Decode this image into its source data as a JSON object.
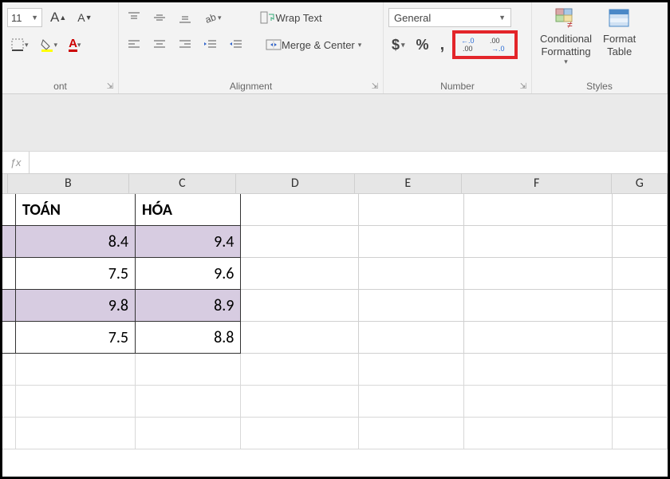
{
  "ribbon": {
    "font": {
      "size": "11",
      "group_label": "ont"
    },
    "alignment": {
      "wrap_text": "Wrap Text",
      "merge_center": "Merge & Center",
      "group_label": "Alignment"
    },
    "number": {
      "format": "General",
      "group_label": "Number"
    },
    "styles": {
      "conditional_formatting": "Conditional\nFormatting",
      "format_table": "Format\nTable",
      "group_label": "Styles"
    }
  },
  "columns": [
    "B",
    "C",
    "D",
    "E",
    "F",
    "G"
  ],
  "headers": {
    "B": "TOÁN",
    "C": "HÓA"
  },
  "chart_data": {
    "type": "table",
    "columns": [
      "TOÁN",
      "HÓA"
    ],
    "rows": [
      [
        8.4,
        9.4
      ],
      [
        7.5,
        9.6
      ],
      [
        9.8,
        8.9
      ],
      [
        7.5,
        8.8
      ]
    ]
  }
}
